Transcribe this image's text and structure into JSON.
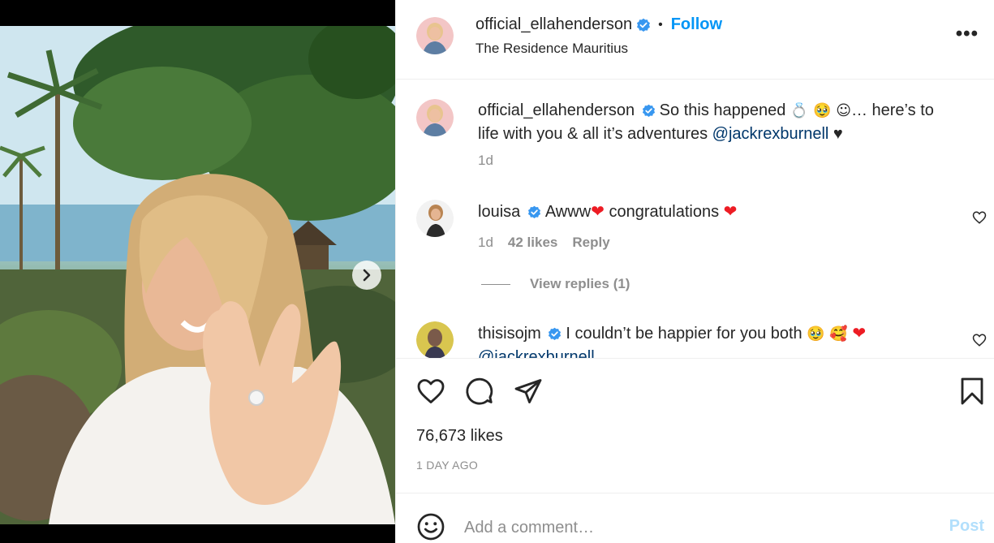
{
  "post": {
    "username": "official_ellahenderson",
    "follow_label": "Follow",
    "location": "The Residence Mauritius",
    "more_label": "•••"
  },
  "caption": {
    "username": "official_ellahenderson",
    "text_before": "So this happened ",
    "emojis": "💍 🥹 ☺",
    "text_after": "… here’s to life with you & all it’s adventures ",
    "mention": "@jackrexburnell",
    "trailing": " ♥",
    "time": "1d"
  },
  "comments": [
    {
      "username": "louisa",
      "text_a": "Awww",
      "text_b": " congratulations ",
      "time": "1d",
      "likes": "42 likes",
      "reply_label": "Reply"
    },
    {
      "username": "thisisojm",
      "text": "I couldn’t be happier for you both ",
      "emojis": "🥹 🥰",
      "mention": "@jackrexburnell"
    }
  ],
  "view_replies_label": "View replies (1)",
  "likes_label": "76,673 likes",
  "time_ago": "1 DAY AGO",
  "add_comment": {
    "placeholder": "Add a comment…",
    "post_label": "Post"
  },
  "colors": {
    "accent": "#0095f6",
    "verified": "#3897f0",
    "mention": "#00376b",
    "muted": "#8e8e8e",
    "post_disabled": "#b2dffc",
    "heart": "#ed1c24"
  },
  "icons": [
    "verified-badge-icon",
    "more-options-icon",
    "chevron-right-icon",
    "heart-icon",
    "comment-icon",
    "share-icon",
    "bookmark-icon",
    "emoji-icon"
  ]
}
